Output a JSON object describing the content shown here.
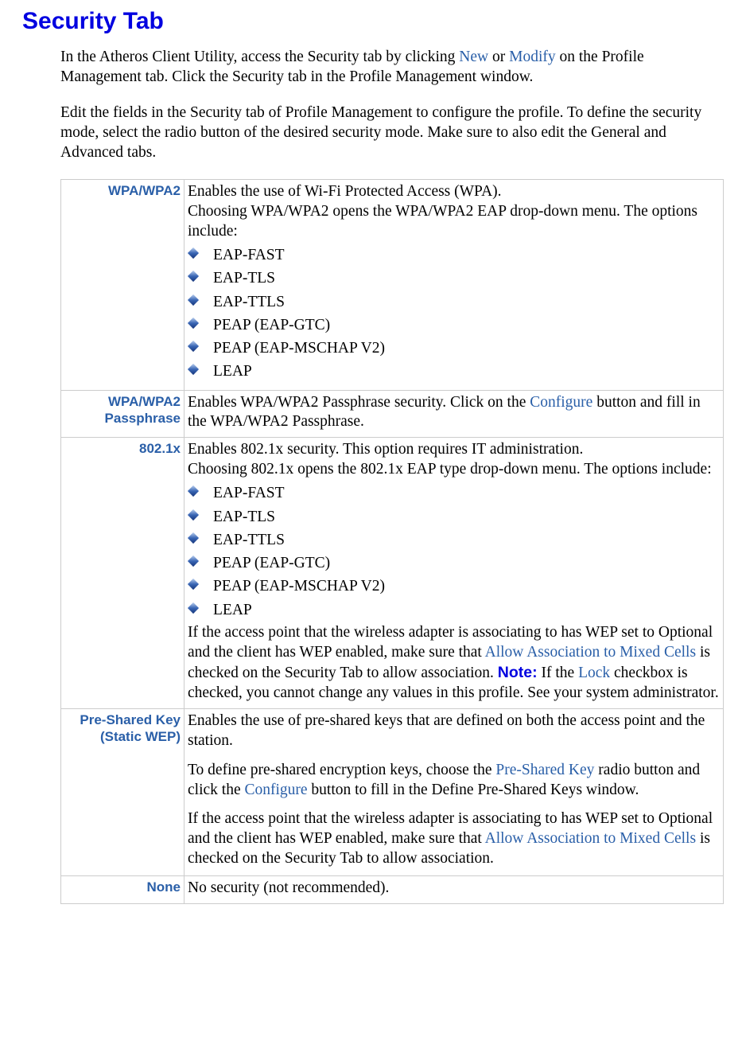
{
  "title": "Security Tab",
  "intro": {
    "p1_a": "In the Atheros Client Utility, access the Security tab by clicking ",
    "link_new": "New",
    "p1_b": " or ",
    "link_modify": "Modify",
    "p1_c": " on the Profile Management tab.  Click the Security tab in the Profile Management window.",
    "p2": "Edit the fields in the Security  tab of Profile Management  to configure the profile. To define the security mode, select the radio button of the desired security mode. Make sure to also edit the General and Advanced tabs."
  },
  "rows": {
    "wpa": {
      "label": "WPA/WPA2",
      "line1": "Enables the use of Wi-Fi Protected Access (WPA).",
      "line2": "Choosing WPA/WPA2 opens the WPA/WPA2 EAP drop-down menu. The options include:",
      "opts": [
        "EAP-FAST",
        "EAP-TLS",
        "EAP-TTLS",
        "PEAP (EAP-GTC)",
        "PEAP (EAP-MSCHAP V2)",
        "LEAP"
      ]
    },
    "wpapass": {
      "label": "WPA/WPA2 Passphrase",
      "t1": "Enables WPA/WPA2 Passphrase security.   Click on the ",
      "link": "Configure",
      "t2": " button and fill in the WPA/WPA2 Passphrase."
    },
    "d1x": {
      "label": "802.1x",
      "line1": "Enables 802.1x security.  This option requires IT administration.",
      "line2": "Choosing 802.1x opens the 802.1x EAP type drop-down menu.  The options include:",
      "opts": [
        "EAP-FAST",
        "EAP-TLS",
        "EAP-TTLS",
        "PEAP (EAP-GTC)",
        "PEAP (EAP-MSCHAP V2)",
        "LEAP"
      ],
      "after_a": "If the access point that the wireless adapter is associating to has WEP set to Optional and the client has WEP enabled, make sure that ",
      "link_mixed": "Allow Association to Mixed Cells",
      "after_b": " is checked on the Security Tab to allow association. ",
      "note_label": "Note:",
      "after_c": " If the ",
      "link_lock": "Lock",
      "after_d": " checkbox is checked, you cannot change any values in this profile. See your system administrator."
    },
    "psk": {
      "label": "Pre-Shared Key (Static WEP)",
      "p1": "Enables the use of pre-shared keys that are defined on both the access point and the station.",
      "p2a": "To define pre-shared encryption keys, choose the ",
      "link_psk": "Pre-Shared Key",
      "p2b": " radio button and click the ",
      "link_cfg": "Configure",
      "p2c": " button to fill in the Define Pre-Shared Keys window.",
      "p3a": "If the access point that the wireless adapter is associating to has WEP set to Optional and the client has WEP enabled, make sure that ",
      "link_mixed": "Allow Association to Mixed Cells",
      "p3b": " is checked on the Security Tab to allow association."
    },
    "none": {
      "label": "None",
      "text": "No security (not recommended)."
    }
  }
}
